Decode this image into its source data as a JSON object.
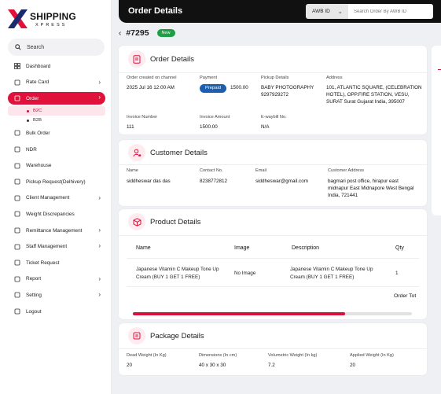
{
  "brand": {
    "name": "SHIPPING",
    "sub": "XPRESS",
    "accent": "#e0123c"
  },
  "search": {
    "label": "Search"
  },
  "sidebar": {
    "items": [
      {
        "label": "Dashboard",
        "icon": "grid-icon",
        "chevron": false
      },
      {
        "label": "Rate Card",
        "icon": "receipt-icon",
        "chevron": true
      },
      {
        "label": "Order",
        "icon": "box-icon",
        "chevron": true,
        "active": true
      },
      {
        "label": "Bulk Order",
        "icon": "truck-icon",
        "chevron": false
      },
      {
        "label": "NDR",
        "icon": "diamond-icon",
        "chevron": false
      },
      {
        "label": "Warehouse",
        "icon": "warehouse-icon",
        "chevron": false
      },
      {
        "label": "Pickup Request(Delhivery)",
        "icon": "car-icon",
        "chevron": false
      },
      {
        "label": "Client Management",
        "icon": "user-icon",
        "chevron": true
      },
      {
        "label": "Weight Discrepancies",
        "icon": "scale-icon",
        "chevron": false
      },
      {
        "label": "Remittance Management",
        "icon": "money-icon",
        "chevron": true
      },
      {
        "label": "Staff Management",
        "icon": "staff-icon",
        "chevron": true
      },
      {
        "label": "Ticket Request",
        "icon": "ticket-icon",
        "chevron": false
      },
      {
        "label": "Report",
        "icon": "shield-icon",
        "chevron": true
      },
      {
        "label": "Setting",
        "icon": "gear-icon",
        "chevron": true
      },
      {
        "label": "Logout",
        "icon": "logout-icon",
        "chevron": false
      }
    ],
    "order_sub": [
      "B2C",
      "B2B"
    ]
  },
  "header": {
    "title": "Order Details",
    "awb_label": "AWB ID",
    "search_placeholder": "Search Order By AWB ID"
  },
  "order": {
    "number": "#7295",
    "status": "New"
  },
  "order_details": {
    "title": "Order Details",
    "created_label": "Order created on channel",
    "created_value": "2025 Jul 16 12:00 AM",
    "payment_label": "Payment",
    "payment_type": "Prepaid",
    "payment_amount": "1500.00",
    "pickup_label": "Pickup Details",
    "pickup_value": "BABY PHOTOGRAPHY 9297929272",
    "address_label": "Address",
    "address_value": "101, ATLANTIC SQUARE, (CELEBRATION HOTEL), OPP.FIRE STATION, VESU, SURAT Surat Gujarat India, 395007",
    "invoice_label": "Invoice Number",
    "invoice_value": "111",
    "invoice_amount_label": "Invoice Amount",
    "invoice_amount_value": "1500.00",
    "ewaybill_label": "E-waybill No.",
    "ewaybill_value": "N/A"
  },
  "customer": {
    "title": "Customer Details",
    "name_label": "Name",
    "name_value": "siddheswar das das",
    "contact_label": "Contact No.",
    "contact_value": "8238772812",
    "email_label": "Email",
    "email_value": "siddheswar@gmail.com",
    "address_label": "Customer Address",
    "address_value": "bagmari post office, hirapur east midnapur East Midnapore West Bengal India, 721441"
  },
  "products": {
    "title": "Product Details",
    "columns": [
      "Name",
      "Image",
      "Description",
      "Qty"
    ],
    "rows": [
      {
        "name": "Japanese Vitamin C Makeup Tone Up Cream (BUY 1 GET 1 FREE)",
        "image": "No Image",
        "description": "Japanese Vitamin C Makeup Tone Up Cream (BUY 1 GET 1 FREE)",
        "qty": "1"
      }
    ],
    "footer": "Order Tot",
    "scroll_fraction": 0.76
  },
  "package": {
    "title": "Package Details",
    "dead_weight_label": "Dead Weight (In Kg)",
    "dead_weight_value": "20",
    "dimensions_label": "Dimensions (In cm)",
    "dimensions_value": "40 x 30 x 30",
    "volumetric_label": "Volumetric Weight (In kg)",
    "volumetric_value": "7.2",
    "applied_label": "Applied Weight (In Kg)",
    "applied_value": "20"
  }
}
